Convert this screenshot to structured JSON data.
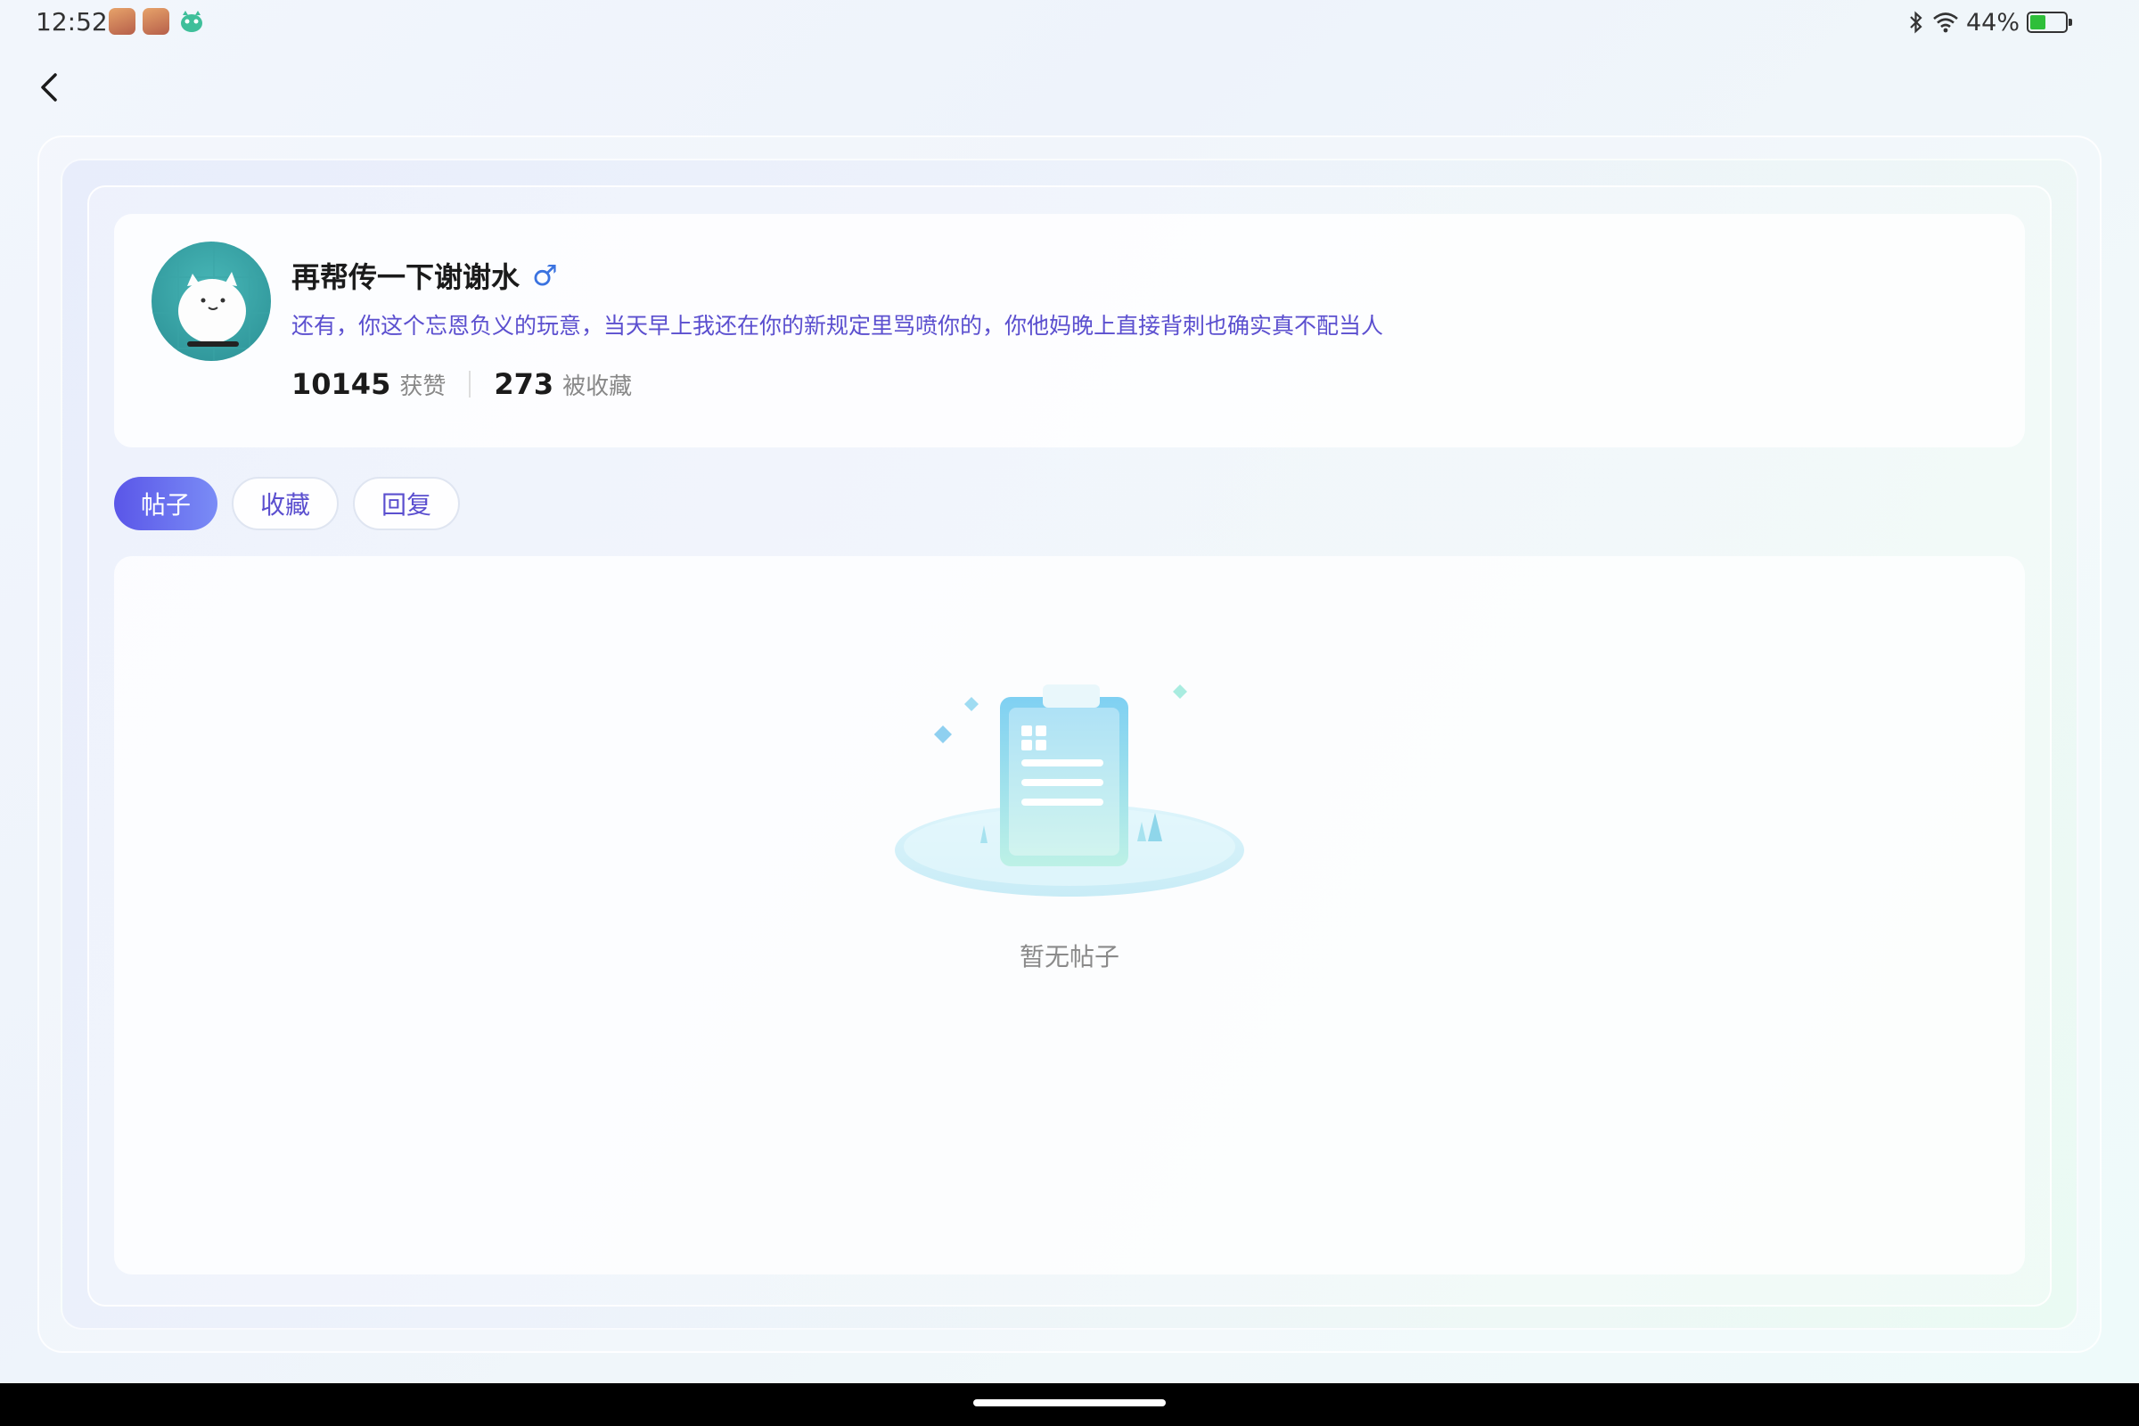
{
  "status_bar": {
    "time": "12:52",
    "battery_level_percent": 44,
    "battery_text": "44%",
    "icons": [
      "notification-app-icon",
      "notification-app-icon",
      "notification-app-icon",
      "bluetooth-icon",
      "wifi-icon",
      "battery-icon"
    ]
  },
  "nav": {
    "back_icon": "chevron-left-icon"
  },
  "profile": {
    "username": "再帮传一下谢谢水",
    "gender_symbol": "♂",
    "bio": "还有，你这个忘恩负义的玩意，当天早上我还在你的新规定里骂喷你的，你他妈晚上直接背刺也确实真不配当人",
    "stats": [
      {
        "value": "10145",
        "label": "获赞"
      },
      {
        "value": "273",
        "label": "被收藏"
      }
    ]
  },
  "tabs": [
    {
      "label": "帖子",
      "active": true
    },
    {
      "label": "收藏",
      "active": false
    },
    {
      "label": "回复",
      "active": false
    }
  ],
  "empty_state": {
    "text": "暂无帖子",
    "illustration_icon": "clipboard-illustration-icon"
  },
  "colors": {
    "accent": "#5a56e8",
    "bio_text": "#5b4fcf",
    "gender": "#3b73e0",
    "battery": "#2fbf3a"
  }
}
